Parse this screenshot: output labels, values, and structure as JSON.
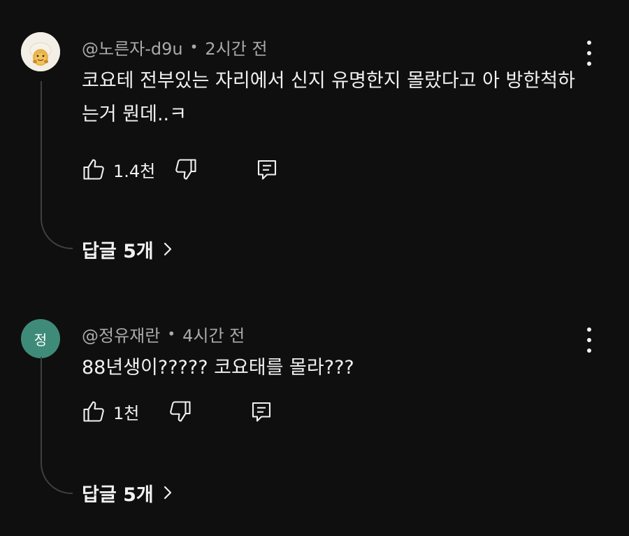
{
  "comments": [
    {
      "author": "@노른자-d9u",
      "separator": "•",
      "time": "2시간 전",
      "text": "코요테 전부있는 자리에서 신지 유명한지 몰랐다고 아 방한척하는거 뭔데..ㅋ",
      "likes": "1.4천",
      "replies_label": "답글 5개",
      "avatar_icon": "egg-character-avatar"
    },
    {
      "author": "@정유재란",
      "separator": "•",
      "time": "4시간 전",
      "text": "88년생이????? 코요태를 몰라???",
      "likes": "1천",
      "replies_label": "답글 5개",
      "avatar_letter": "정",
      "avatar_color": "#3f8b79"
    }
  ],
  "icons": {
    "like": "thumb-up-icon",
    "dislike": "thumb-down-icon",
    "reply": "comment-reply-icon",
    "more": "more-vertical-icon",
    "chevron": "chevron-right-icon"
  },
  "colors": {
    "background": "#0f0f0f",
    "text": "#f1f1f1",
    "meta": "#aaaaaa"
  }
}
